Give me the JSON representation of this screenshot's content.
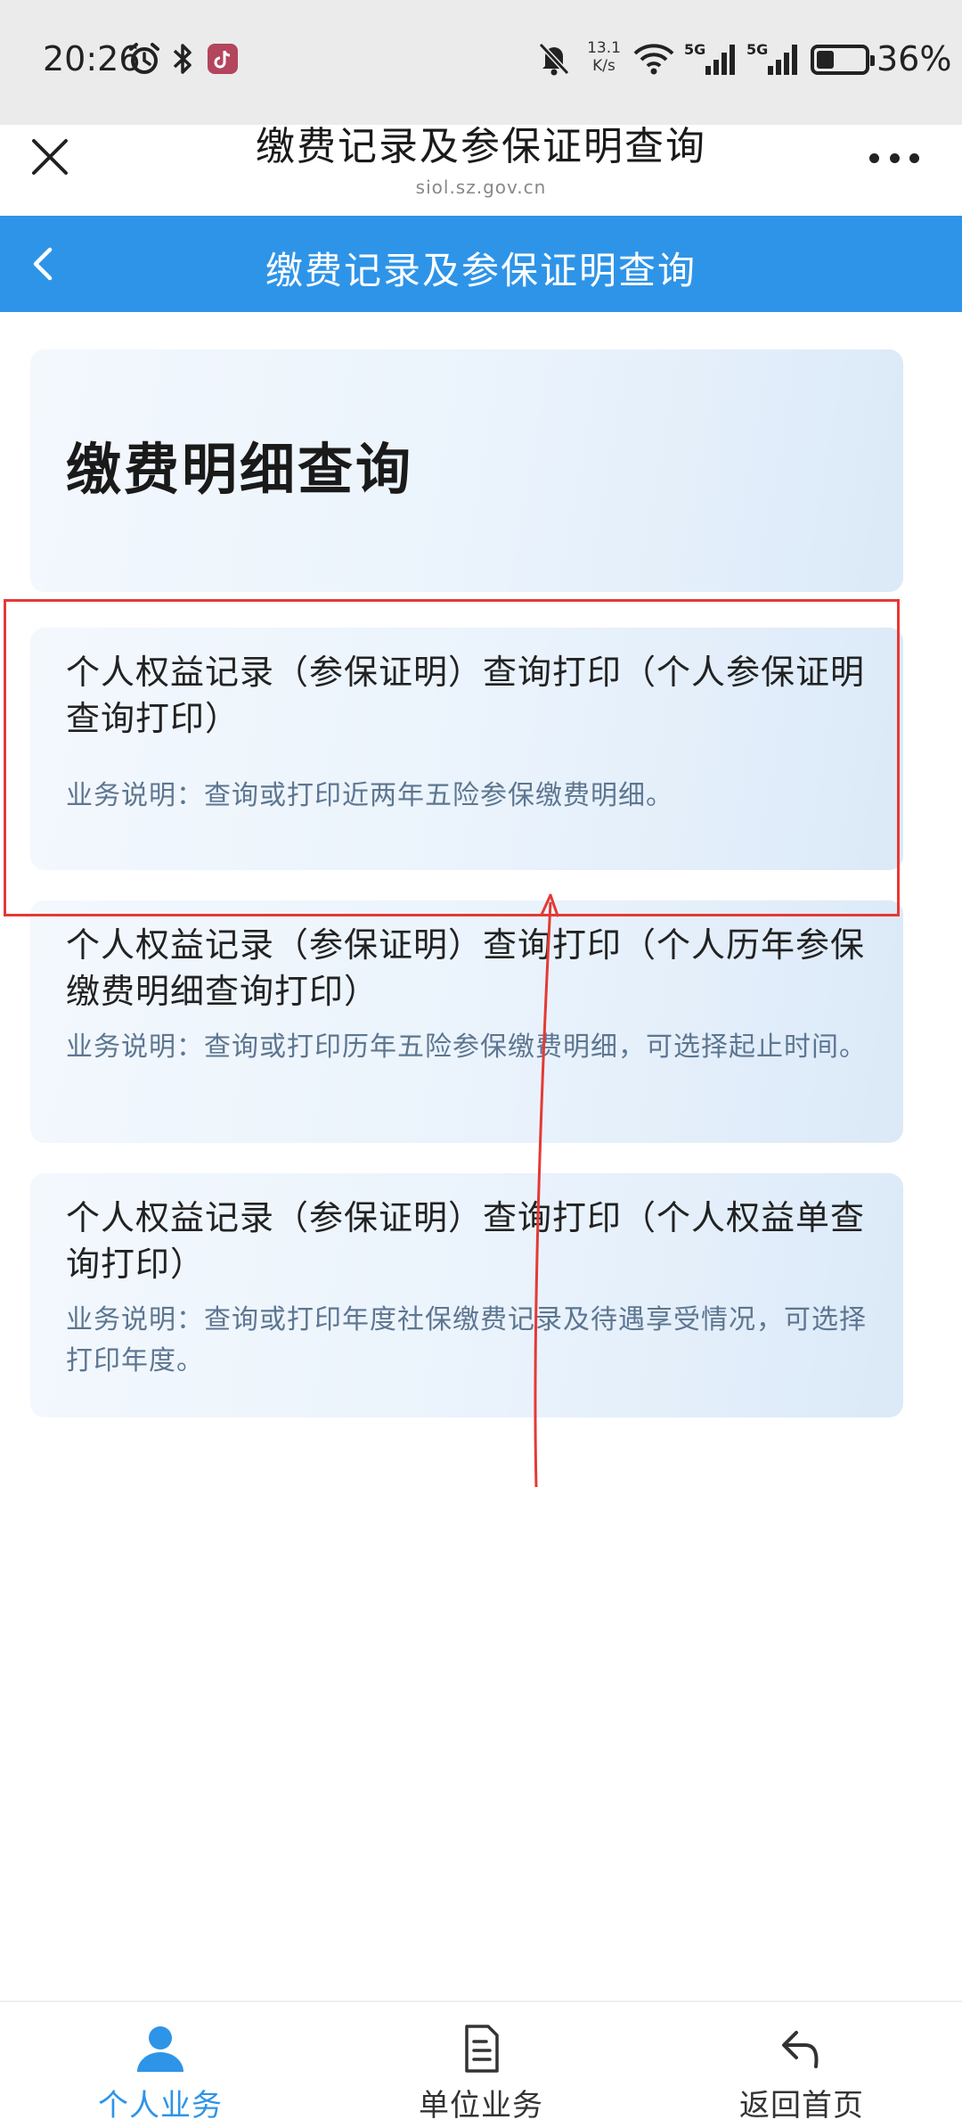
{
  "status_bar": {
    "time": "20:26",
    "net_speed_value": "13.1",
    "net_speed_unit": "K/s",
    "signal_1": "5G",
    "signal_2": "5G",
    "battery_percent": "36%",
    "battery_level": 0.36
  },
  "title_bar": {
    "title": "缴费记录及参保证明查询",
    "url": "siol.sz.gov.cn"
  },
  "nav": {
    "title": "缴费记录及参保证明查询"
  },
  "header_card": {
    "title": "缴费明细查询"
  },
  "services": [
    {
      "title": "个人权益记录（参保证明）查询打印（个人参保证明查询打印）",
      "description": "业务说明：查询或打印近两年五险参保缴费明细。"
    },
    {
      "title": "个人权益记录（参保证明）查询打印（个人历年参保缴费明细查询打印）",
      "description": "业务说明：查询或打印历年五险参保缴费明细，可选择起止时间。"
    },
    {
      "title": "个人权益记录（参保证明）查询打印（个人权益单查询打印）",
      "description": "业务说明：查询或打印年度社保缴费记录及待遇享受情况，可选择打印年度。"
    }
  ],
  "bottom_nav": {
    "personal": "个人业务",
    "unit": "单位业务",
    "home": "返回首页"
  },
  "colors": {
    "accent": "#2e94e8",
    "annotation": "#e53935",
    "description_text": "#5d7691"
  },
  "icons": {
    "close": "close-icon",
    "more": "more-icon",
    "back": "chevron-left-icon",
    "personal": "person-icon",
    "unit": "document-icon",
    "home": "return-icon"
  }
}
